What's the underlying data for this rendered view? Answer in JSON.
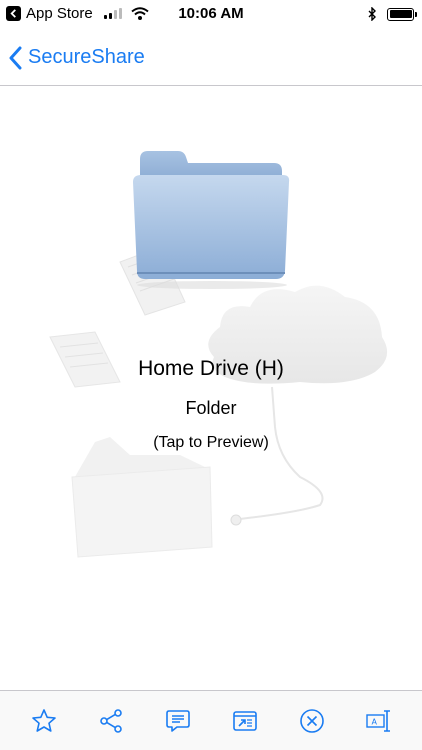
{
  "status_bar": {
    "carrier": "App Store",
    "time": "10:06 AM"
  },
  "nav": {
    "back_label": "SecureShare"
  },
  "file": {
    "name": "Home Drive (H)",
    "type": "Folder",
    "hint": "(Tap to Preview)"
  },
  "toolbar": {
    "items": [
      "star-icon",
      "share-icon",
      "comment-icon",
      "open-in-icon",
      "close-icon",
      "rename-icon"
    ]
  },
  "colors": {
    "accent": "#1a7cf2",
    "folder": "#8fb3dc"
  }
}
